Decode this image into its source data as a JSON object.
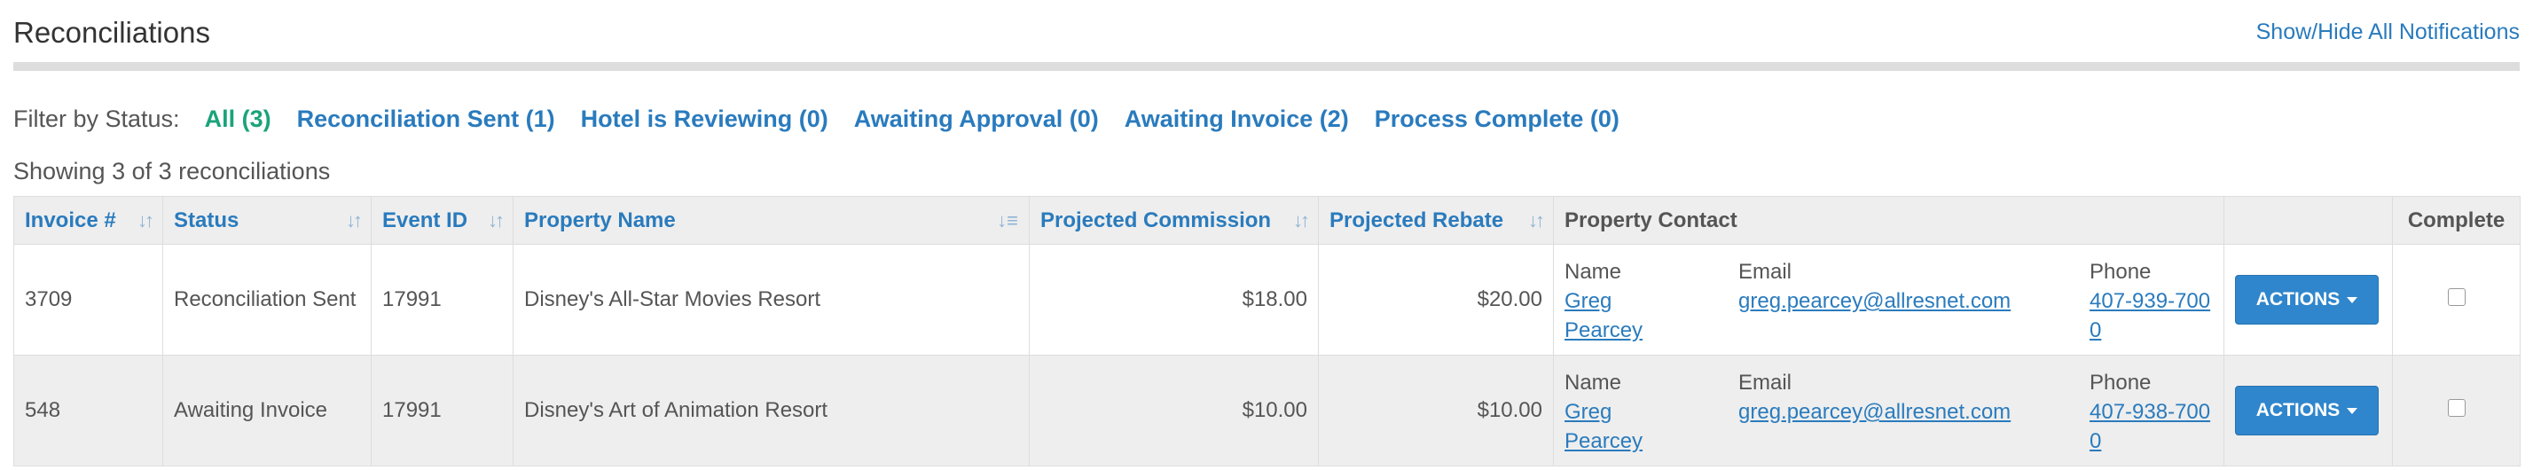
{
  "page": {
    "title": "Reconciliations",
    "toggle_notifications": "Show/Hide All Notifications"
  },
  "filter": {
    "label": "Filter by Status:",
    "options": [
      {
        "label": "All (3)",
        "active": true
      },
      {
        "label": "Reconciliation Sent (1)",
        "active": false
      },
      {
        "label": "Hotel is Reviewing (0)",
        "active": false
      },
      {
        "label": "Awaiting Approval (0)",
        "active": false
      },
      {
        "label": "Awaiting Invoice (2)",
        "active": false
      },
      {
        "label": "Process Complete (0)",
        "active": false
      }
    ]
  },
  "summary": "Showing 3 of 3 reconciliations",
  "table": {
    "columns": {
      "invoice": "Invoice #",
      "status": "Status",
      "event_id": "Event ID",
      "property_name": "Property Name",
      "projected_commission": "Projected Commission",
      "projected_rebate": "Projected Rebate",
      "property_contact": "Property Contact",
      "actions": "",
      "complete": "Complete"
    },
    "contact_labels": {
      "name": "Name",
      "email": "Email",
      "phone": "Phone"
    },
    "rows": [
      {
        "invoice": "3709",
        "status": "Reconciliation Sent",
        "event_id": "17991",
        "property_name": "Disney's All-Star Movies Resort",
        "projected_commission": "$18.00",
        "projected_rebate": "$20.00",
        "contact_name_line1": "Greg",
        "contact_name_line2": "Pearcey",
        "contact_email": "greg.pearcey@allresnet.com",
        "contact_phone_line1": "407-939-700",
        "contact_phone_line2": "0",
        "actions_label": "ACTIONS",
        "complete": false
      },
      {
        "invoice": "548",
        "status": "Awaiting Invoice",
        "event_id": "17991",
        "property_name": "Disney's Art of Animation Resort",
        "projected_commission": "$10.00",
        "projected_rebate": "$10.00",
        "contact_name_line1": "Greg",
        "contact_name_line2": "Pearcey",
        "contact_email": "greg.pearcey@allresnet.com",
        "contact_phone_line1": "407-938-700",
        "contact_phone_line2": "0",
        "actions_label": "ACTIONS",
        "complete": false
      }
    ]
  },
  "colors": {
    "link": "#2a7bbd",
    "active_filter": "#1aa37a",
    "button": "#2f86cc",
    "header_bg": "#eeeeee"
  }
}
